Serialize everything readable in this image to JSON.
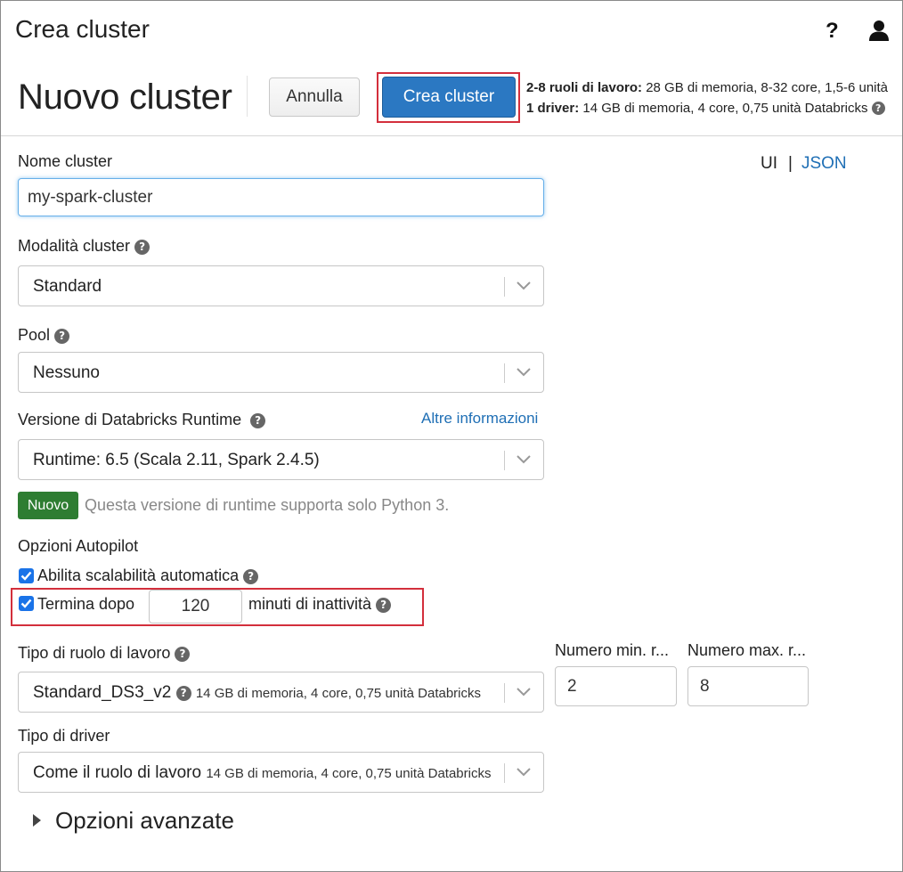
{
  "app": {
    "title": "Crea cluster",
    "help_label": "?"
  },
  "header": {
    "title": "Nuovo cluster",
    "cancel_label": "Annulla",
    "create_label": "Crea cluster",
    "summary": {
      "workers_bold": "2-8 ruoli di lavoro:",
      "workers_text": " 28 GB di memoria, 8-32 core, 1,5-6 unità",
      "driver_bold": "1 driver:",
      "driver_text": " 14 GB di memoria, 4 core, 0,75 unità Databricks"
    }
  },
  "view_toggle": {
    "ui_label": "UI",
    "separator": "|",
    "json_label": "JSON"
  },
  "form": {
    "cluster_name": {
      "label": "Nome cluster",
      "value": "my-spark-cluster"
    },
    "cluster_mode": {
      "label": "Modalità cluster",
      "value": "Standard"
    },
    "pool": {
      "label": "Pool",
      "value": "Nessuno"
    },
    "runtime": {
      "label": "Versione di Databricks Runtime",
      "more_info": "Altre informazioni",
      "value": "Runtime: 6.5 (Scala 2.11, Spark 2.4.5)",
      "badge": "Nuovo",
      "note": "Questa versione di runtime supporta solo Python 3."
    },
    "autopilot": {
      "label": "Opzioni Autopilot",
      "autoscale_label": "Abilita scalabilità automatica",
      "autoscale_checked": true,
      "terminate_label": "Termina dopo",
      "terminate_checked": true,
      "terminate_minutes": "120",
      "terminate_suffix": "minuti di inattività"
    },
    "worker_type": {
      "label": "Tipo di ruolo di lavoro",
      "value": "Standard_DS3_v2",
      "detail": "14 GB di memoria, 4 core, 0,75 unità Databricks",
      "min_label": "Numero min. r...",
      "min_value": "2",
      "max_label": "Numero max. r...",
      "max_value": "8"
    },
    "driver_type": {
      "label": "Tipo di driver",
      "value": "Come il ruolo di lavoro",
      "detail": "14 GB di memoria, 4 core, 0,75 unità Databricks"
    },
    "advanced": {
      "label": "Opzioni avanzate"
    }
  },
  "colors": {
    "primary": "#2b78c2",
    "link": "#1f6fb5",
    "badge": "#2e7d32",
    "highlight": "#d32f3c",
    "checkbox": "#1a73e8"
  },
  "icons": [
    "help-icon",
    "user-icon",
    "question-circle-icon",
    "chevron-down-icon",
    "checkmark-icon",
    "caret-right-icon"
  ]
}
